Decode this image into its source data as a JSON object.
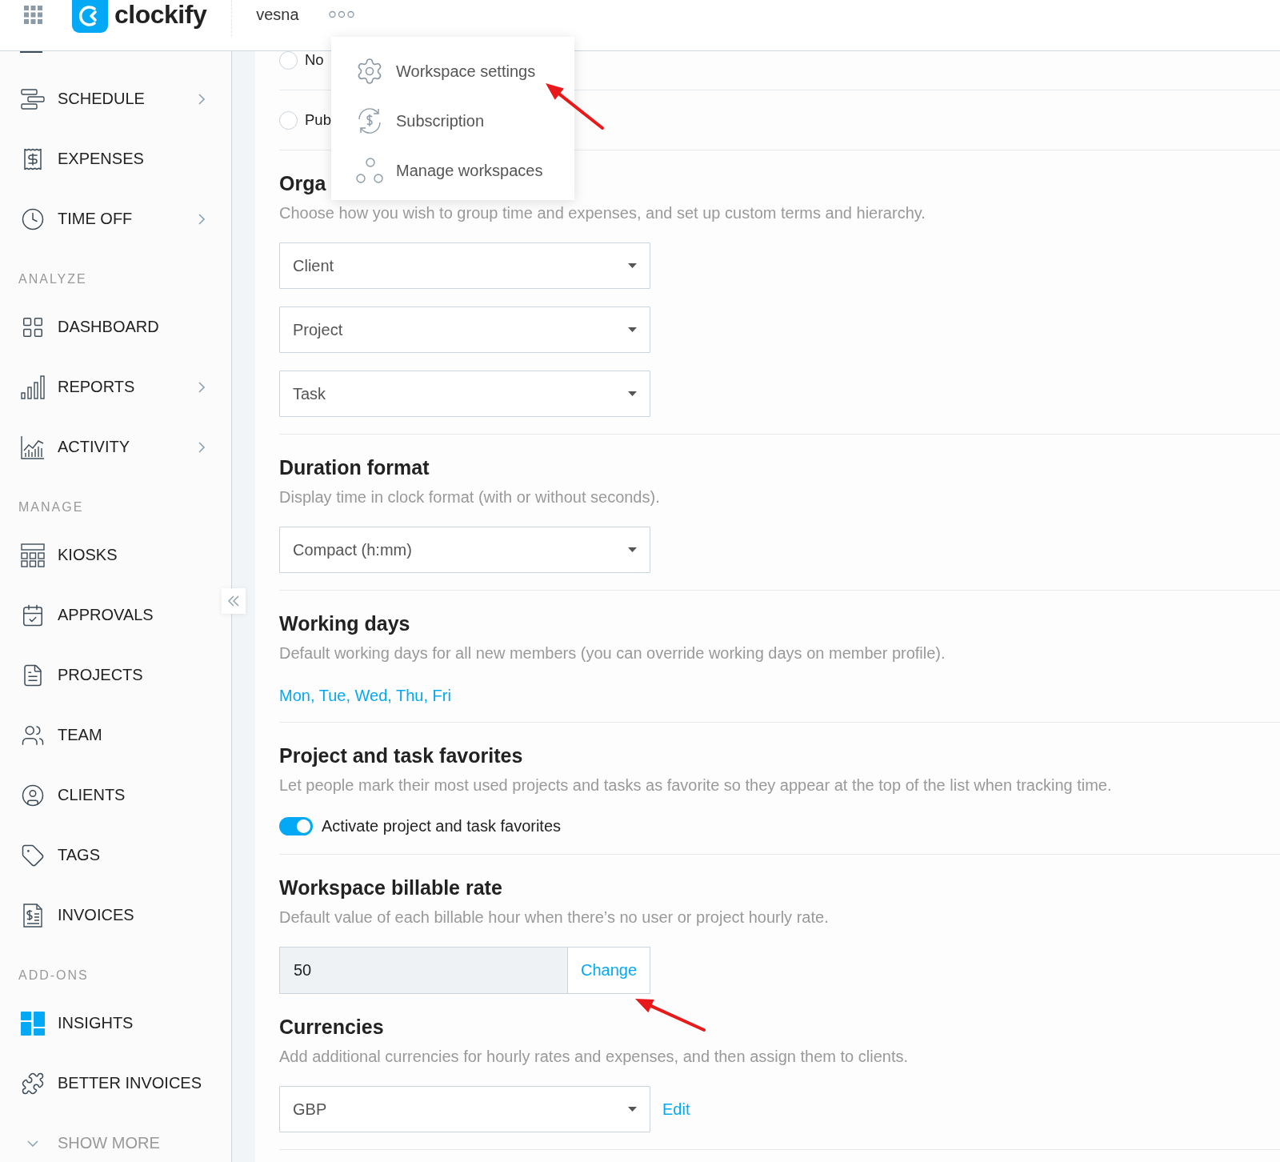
{
  "header": {
    "logo": "clockify",
    "workspace": "vesna"
  },
  "menu": {
    "items": [
      {
        "label": "Workspace settings"
      },
      {
        "label": "Subscription"
      },
      {
        "label": "Manage workspaces"
      }
    ]
  },
  "sidebar": {
    "sections": [
      {
        "items": [
          {
            "label": "SCHEDULE",
            "has_submenu": true
          },
          {
            "label": "EXPENSES",
            "has_submenu": false
          },
          {
            "label": "TIME OFF",
            "has_submenu": true
          }
        ]
      },
      {
        "title": "ANALYZE",
        "items": [
          {
            "label": "DASHBOARD",
            "has_submenu": false
          },
          {
            "label": "REPORTS",
            "has_submenu": true
          },
          {
            "label": "ACTIVITY",
            "has_submenu": true
          }
        ]
      },
      {
        "title": "MANAGE",
        "items": [
          {
            "label": "KIOSKS",
            "has_submenu": false
          },
          {
            "label": "APPROVALS",
            "has_submenu": false
          },
          {
            "label": "PROJECTS",
            "has_submenu": false
          },
          {
            "label": "TEAM",
            "has_submenu": false
          },
          {
            "label": "CLIENTS",
            "has_submenu": false
          },
          {
            "label": "TAGS",
            "has_submenu": false
          },
          {
            "label": "INVOICES",
            "has_submenu": false
          }
        ]
      },
      {
        "title": "ADD-ONS",
        "items": [
          {
            "label": "INSIGHTS",
            "has_submenu": false
          },
          {
            "label": "BETTER INVOICES",
            "has_submenu": false
          }
        ]
      }
    ],
    "show_more": "SHOW MORE"
  },
  "content": {
    "options": [
      {
        "label": "No",
        "selected": false
      },
      {
        "label": "Pub",
        "selected": false
      }
    ],
    "sections": [
      {
        "kind": "selects",
        "title": "Orga",
        "description": "Choose how you wish to group time and expenses, and set up custom terms and hierarchy.",
        "selects": [
          "Client",
          "Project",
          "Task"
        ]
      },
      {
        "kind": "selects",
        "title": "Duration format",
        "description": "Display time in clock format (with or without seconds).",
        "selects": [
          "Compact (h:mm)"
        ]
      },
      {
        "kind": "link",
        "title": "Working days",
        "description": "Default working days for all new members (you can override working days on member profile).",
        "link": "Mon, Tue, Wed, Thu, Fri"
      },
      {
        "kind": "toggle",
        "title": "Project and task favorites",
        "description": "Let people mark their most used projects and tasks as favorite so they appear at the top of the list when tracking time.",
        "toggle": {
          "label": "Activate project and task favorites",
          "on": true
        }
      },
      {
        "kind": "rate",
        "title": "Workspace billable rate",
        "description": "Default value of each billable hour when there’s no user or project hourly rate.",
        "value": "50",
        "button": "Change"
      },
      {
        "kind": "currency",
        "title": "Currencies",
        "description": "Add additional currencies for hourly rates and expenses, and then assign them to clients.",
        "select": "GBP",
        "link": "Edit"
      }
    ]
  }
}
